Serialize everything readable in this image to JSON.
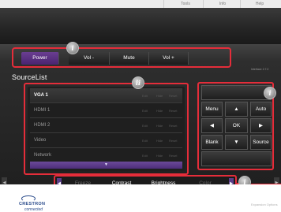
{
  "top_menu": {
    "tabs": [
      {
        "label": "Tools"
      },
      {
        "label": "Info"
      },
      {
        "label": "Help"
      }
    ]
  },
  "power_panel": {
    "buttons": [
      {
        "label": "Power",
        "active": true
      },
      {
        "label": "Vol -"
      },
      {
        "label": "Mute"
      },
      {
        "label": "Vol +"
      }
    ],
    "badge": "i"
  },
  "interface_version": "Interface 2.7.2",
  "source_list": {
    "title": "SourceList",
    "badge": "ii",
    "scroll_down_symbol": "▼",
    "action_labels": {
      "edit": "Edit",
      "hide": "Hide",
      "reset": "Reset"
    },
    "items": [
      {
        "name": "VGA 1",
        "selected": true
      },
      {
        "name": "HDMI 1"
      },
      {
        "name": "HDMI 2"
      },
      {
        "name": "Video"
      },
      {
        "name": "Network"
      }
    ]
  },
  "remote_panel": {
    "badge": "i",
    "buttons": {
      "menu": "Menu",
      "up": "▲",
      "auto": "Auto",
      "left": "◀",
      "ok": "OK",
      "right": "▶",
      "blank": "Blank",
      "down": "▼",
      "source": "Source"
    }
  },
  "image_adjust": {
    "badge": "i",
    "prev_symbol": "◀",
    "next_symbol": "▶",
    "buttons": [
      {
        "label": "Freeze",
        "enabled": false
      },
      {
        "label": "Contrast",
        "enabled": true
      },
      {
        "label": "Brightness",
        "enabled": true
      },
      {
        "label": "Color",
        "enabled": false
      }
    ]
  },
  "footer": {
    "logo_text": "CRESTRON",
    "logo_sub": "connected",
    "expansion_label": "Expansion Options"
  },
  "colors": {
    "highlight_red": "#e52d3a",
    "accent_purple": "#5a3282",
    "panel_dark": "#262626"
  }
}
